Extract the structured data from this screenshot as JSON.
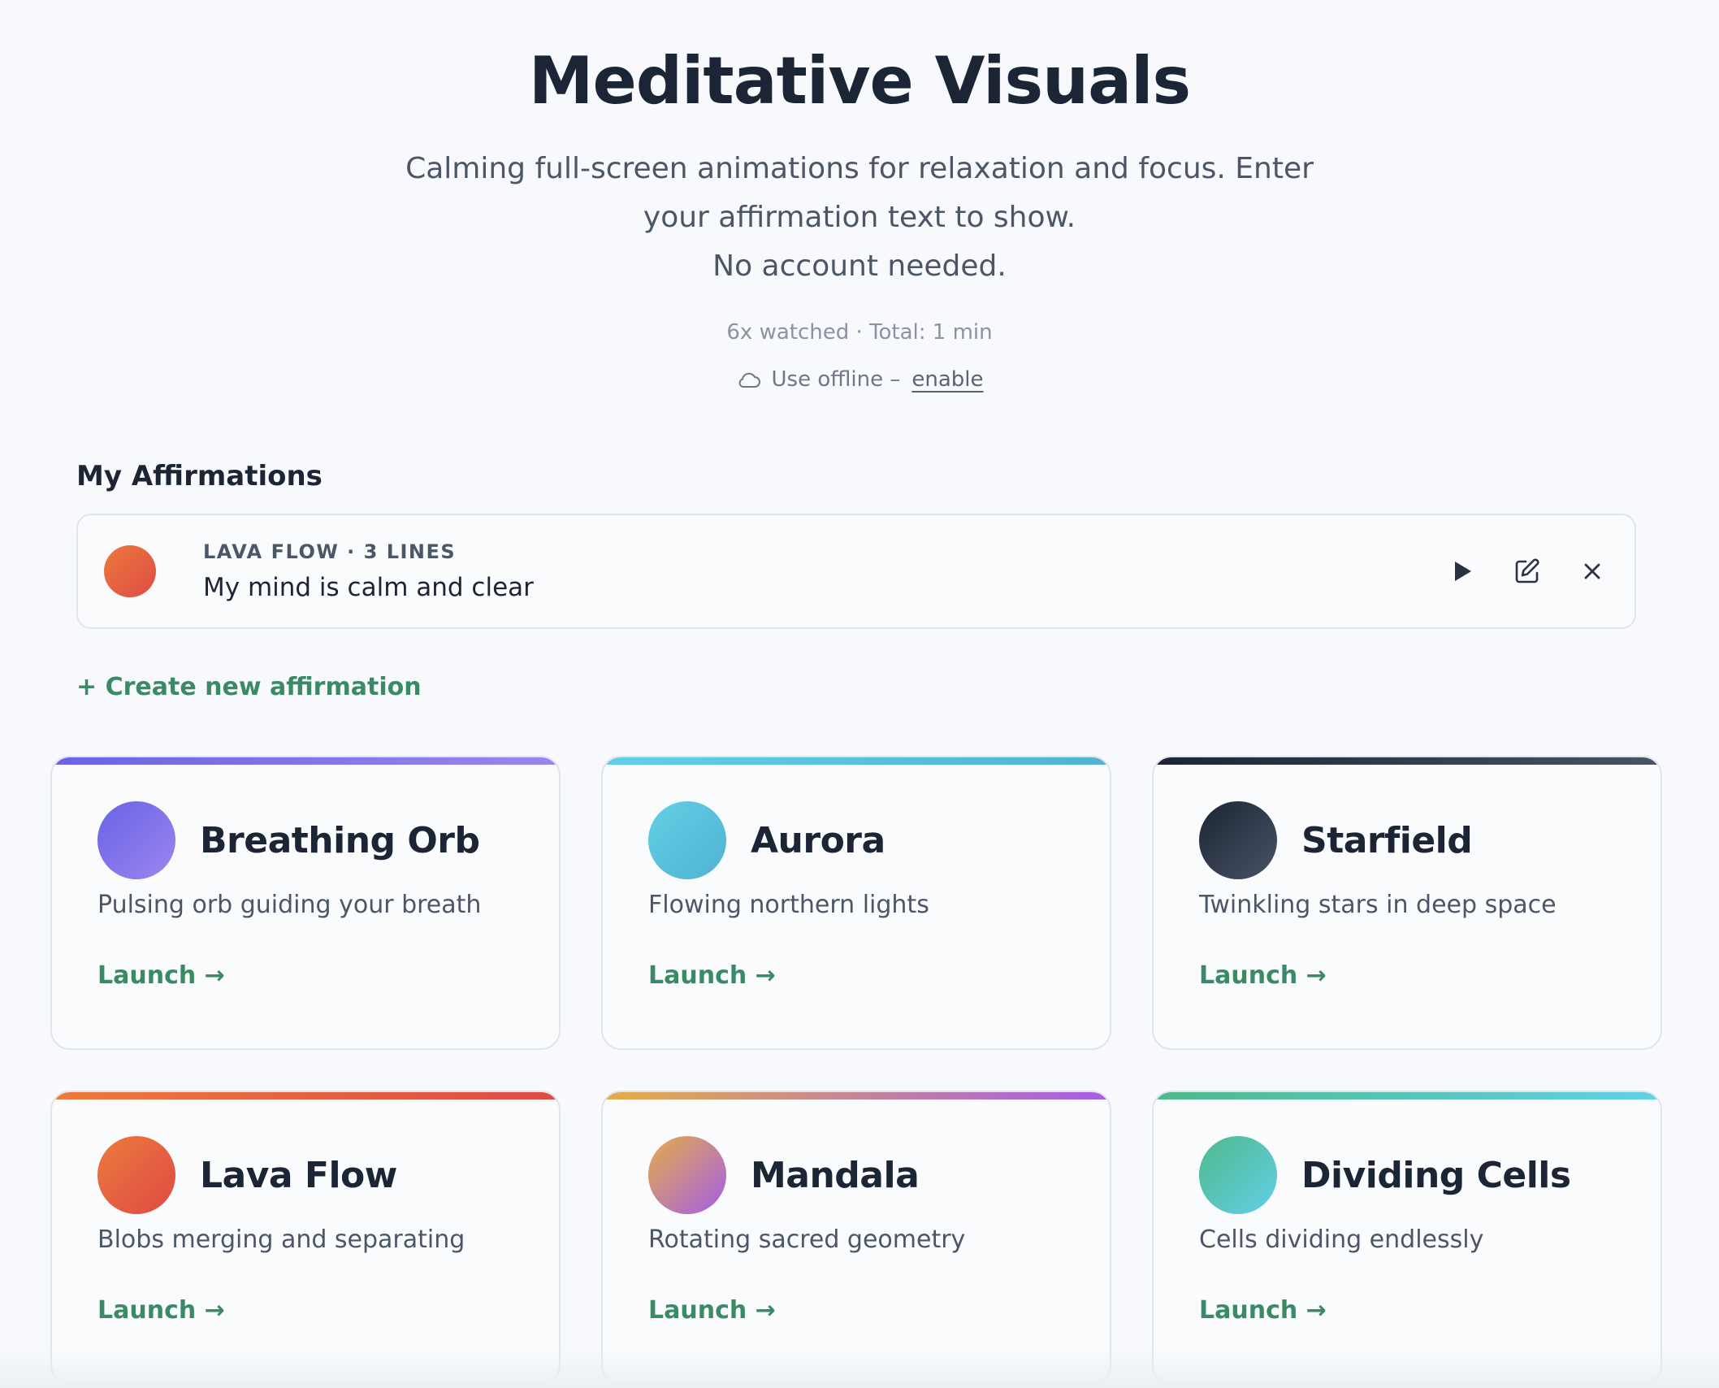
{
  "hero": {
    "title": "Meditative Visuals",
    "subtitle": "Calming full-screen animations for relaxation and focus. Enter your affirmation text to show.",
    "subtitle2": "No account needed.",
    "stats": "6x watched · Total: 1 min",
    "offline_label": "Use offline –",
    "offline_link": "enable",
    "offline_icon": "cloud-icon"
  },
  "affirmations": {
    "title": "My Affirmations",
    "items": [
      {
        "meta": "LAVA FLOW · 3 LINES",
        "text": "My mind is calm and clear",
        "color_from": "#ed7a3c",
        "color_to": "#dd4b45"
      }
    ],
    "create_label": "+ Create new affirmation"
  },
  "visuals": [
    {
      "title": "Breathing Orb",
      "desc": "Pulsing orb guiding your breath",
      "launch": "Launch →",
      "from": "#6a63e6",
      "to": "#9a86ee"
    },
    {
      "title": "Aurora",
      "desc": "Flowing northern lights",
      "launch": "Launch →",
      "from": "#63cfe6",
      "to": "#4fb3d1"
    },
    {
      "title": "Starfield",
      "desc": "Twinkling stars in deep space",
      "launch": "Launch →",
      "from": "#1c2535",
      "to": "#4a5366"
    },
    {
      "title": "Lava Flow",
      "desc": "Blobs merging and separating",
      "launch": "Launch →",
      "from": "#ed7a3c",
      "to": "#dd4b45"
    },
    {
      "title": "Mandala",
      "desc": "Rotating sacred geometry",
      "launch": "Launch →",
      "from": "#e4ad48",
      "to": "#a55de8"
    },
    {
      "title": "Dividing Cells",
      "desc": "Cells dividing endlessly",
      "launch": "Launch →",
      "from": "#4fb98a",
      "to": "#62d0e8"
    }
  ]
}
